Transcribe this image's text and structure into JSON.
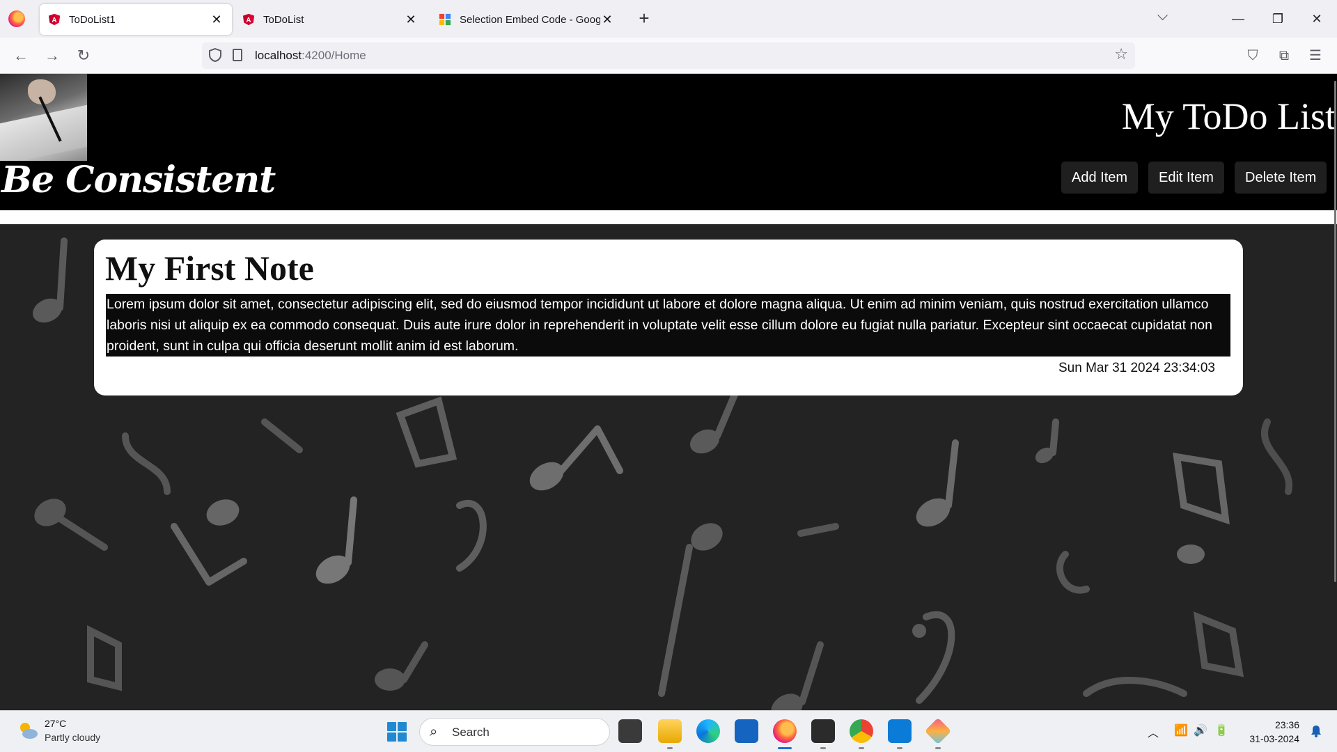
{
  "browser": {
    "tabs": [
      {
        "title": "ToDoList1",
        "active": true,
        "icon": "angular-icon"
      },
      {
        "title": "ToDoList",
        "active": false,
        "icon": "angular-icon"
      },
      {
        "title": "Selection Embed Code - Googl",
        "active": false,
        "icon": "google-icon"
      }
    ],
    "url_host": "localhost",
    "url_path": ":4200/Home"
  },
  "app": {
    "motto": "Be Consistent",
    "title": "My ToDo List",
    "buttons": {
      "add": "Add Item",
      "edit": "Edit Item",
      "delete": "Delete Item"
    }
  },
  "note": {
    "title": "My First Note",
    "body": "Lorem ipsum dolor sit amet, consectetur adipiscing elit, sed do eiusmod tempor incididunt ut labore et dolore magna aliqua. Ut enim ad minim veniam, quis nostrud exercitation ullamco laboris nisi ut aliquip ex ea commodo consequat. Duis aute irure dolor in reprehenderit in voluptate velit esse cillum dolore eu fugiat nulla pariatur. Excepteur sint occaecat cupidatat non proident, sunt in culpa qui officia deserunt mollit anim id est laborum.",
    "date": "Sun Mar 31 2024 23:34:03"
  },
  "taskbar": {
    "weather_temp": "27°C",
    "weather_cond": "Partly cloudy",
    "search_label": "Search",
    "time": "23:36",
    "date": "31-03-2024"
  },
  "colors": {
    "header_bg": "#000000",
    "page_bg": "#232323",
    "note_body_bg": "#0b0b0b"
  }
}
